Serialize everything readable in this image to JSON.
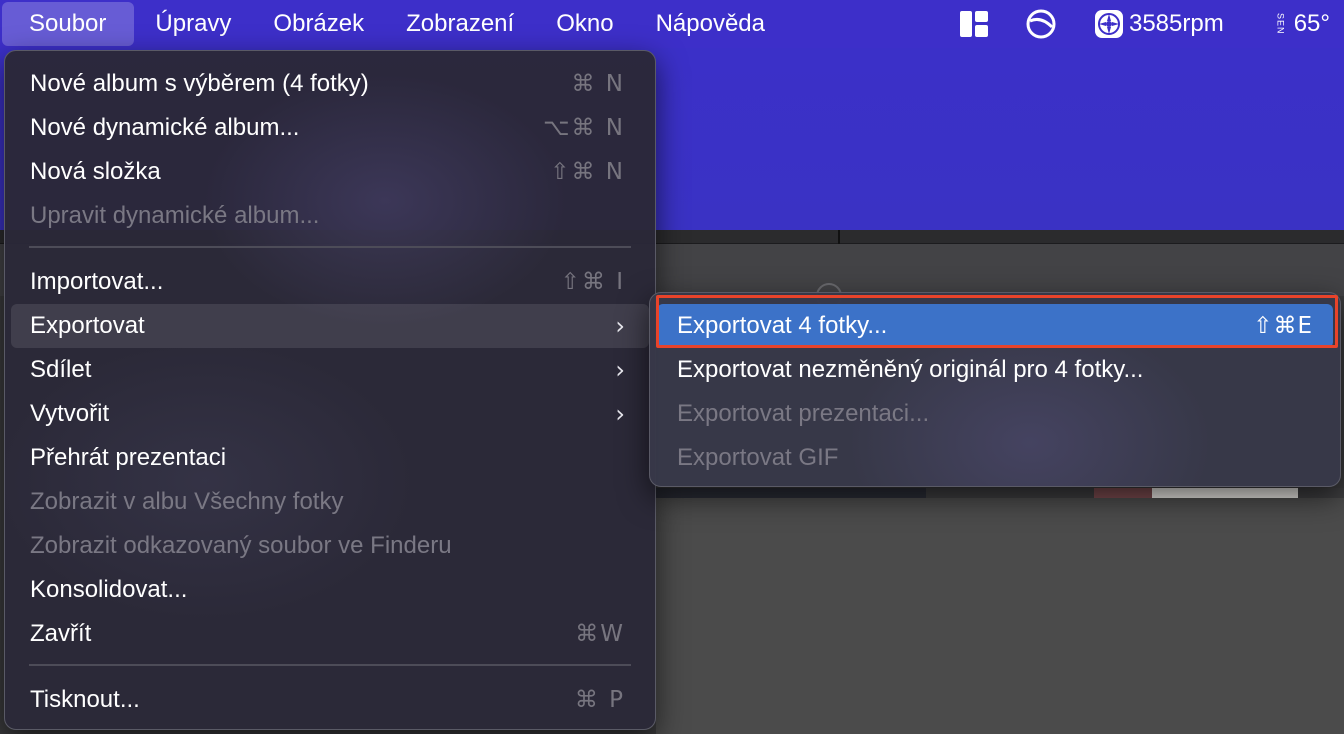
{
  "menubar": {
    "items": [
      "Soubor",
      "Úpravy",
      "Obrázek",
      "Zobrazení",
      "Okno",
      "Nápověda"
    ],
    "active_index": 0,
    "status": {
      "fan_speed": "3585rpm",
      "temperature": "65°",
      "temp_label": "SEN"
    }
  },
  "file_menu": {
    "items": [
      {
        "label": "Nové album s výběrem (4 fotky)",
        "shortcut": "⌘ N",
        "enabled": true
      },
      {
        "label": "Nové dynamické album...",
        "shortcut": "⌥⌘ N",
        "enabled": true
      },
      {
        "label": "Nová složka",
        "shortcut": "⇧⌘ N",
        "enabled": true
      },
      {
        "label": "Upravit dynamické album...",
        "shortcut": "",
        "enabled": false
      },
      {
        "label": "Importovat...",
        "shortcut": "⇧⌘ I",
        "enabled": true
      },
      {
        "label": "Exportovat",
        "shortcut": "",
        "submenu": true,
        "enabled": true
      },
      {
        "label": "Sdílet",
        "shortcut": "",
        "submenu": true,
        "enabled": true
      },
      {
        "label": "Vytvořit",
        "shortcut": "",
        "submenu": true,
        "enabled": true
      },
      {
        "label": "Přehrát prezentaci",
        "shortcut": "",
        "enabled": true
      },
      {
        "label": "Zobrazit v albu Všechny fotky",
        "shortcut": "",
        "enabled": false
      },
      {
        "label": "Zobrazit odkazovaný soubor ve Finderu",
        "shortcut": "",
        "enabled": false
      },
      {
        "label": "Konsolidovat...",
        "shortcut": "",
        "enabled": true
      },
      {
        "label": "Zavřít",
        "shortcut": "⌘W",
        "enabled": true
      },
      {
        "label": "Tisknout...",
        "shortcut": "⌘ P",
        "enabled": true
      }
    ]
  },
  "export_submenu": {
    "items": [
      {
        "label": "Exportovat 4 fotky...",
        "shortcut": "⇧⌘E",
        "enabled": true,
        "selected": true
      },
      {
        "label": "Exportovat nezměněný originál pro 4 fotky...",
        "shortcut": "",
        "enabled": true
      },
      {
        "label": "Exportovat prezentaci...",
        "shortcut": "",
        "enabled": false
      },
      {
        "label": "Exportovat GIF",
        "shortcut": "",
        "enabled": false
      }
    ]
  },
  "colors": {
    "menubar_bg": "#3d2fc9",
    "selection": "#3c72c8",
    "highlight_outline": "#e8432a"
  }
}
